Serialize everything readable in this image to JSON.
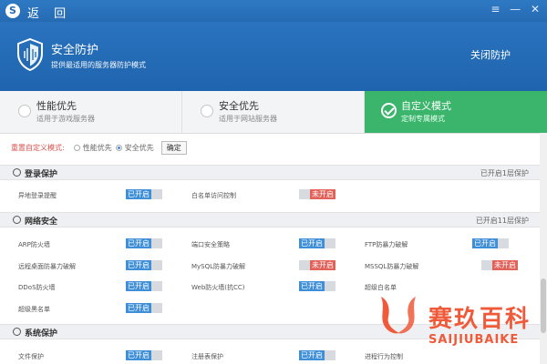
{
  "titlebar": {
    "back_label": "返 回",
    "logo_text": "S",
    "btn_menu": "≡",
    "btn_min": "—",
    "btn_close": "✕"
  },
  "banner": {
    "title": "安全防护",
    "subtitle": "提供最适用的服务器防护模式",
    "close_protect": "关闭防护"
  },
  "modes": [
    {
      "title": "性能优先",
      "subtitle": "适用于游戏服务器"
    },
    {
      "title": "安全优先",
      "subtitle": "适用于网站服务器"
    },
    {
      "title": "自定义模式",
      "subtitle": "定制专属模式"
    }
  ],
  "reset": {
    "label": "重置自定义模式:",
    "option1": "性能优先",
    "option2": "安全优先",
    "confirm": "确定"
  },
  "status_labels": {
    "on": "已开启",
    "off": "未开启"
  },
  "sections": {
    "login": {
      "title": "登录保护",
      "status": "已开启1层保护",
      "items": [
        {
          "label": "异地登录提醒",
          "state": "已开启"
        },
        {
          "label": "白名单访问控制",
          "state": "未开启"
        }
      ]
    },
    "network": {
      "title": "网络安全",
      "status": "已开启11层保护",
      "items": [
        {
          "label": "ARP防火墙",
          "state": "已开启"
        },
        {
          "label": "端口安全策略",
          "state": "已开启"
        },
        {
          "label": "FTP防暴力破解",
          "state": "已开启"
        },
        {
          "label": "远程桌面防暴力破解",
          "state": "已开启"
        },
        {
          "label": "MySQL防暴力破解",
          "state": "未开启"
        },
        {
          "label": "MSSQL防暴力破解",
          "state": "未开启"
        },
        {
          "label": "DDoS防火墙",
          "state": "已开启"
        },
        {
          "label": "Web防火墙(抗CC)",
          "state": "已开启"
        },
        {
          "label": "超级白名单",
          "state": ""
        },
        {
          "label": "超级黑名单",
          "state": "已开启"
        }
      ]
    },
    "system": {
      "title": "系统保护",
      "items": [
        {
          "label": "文件保护",
          "state": "已开启"
        },
        {
          "label": "注册表保护",
          "state": "已开启"
        },
        {
          "label": "进程行为控制",
          "state": ""
        }
      ]
    }
  },
  "watermark": {
    "cn": "赛玖百科",
    "en": "SAIJIUBAIKE"
  },
  "colors": {
    "primary": "#256bb3",
    "active_mode": "#3bb56c",
    "on": "#3e8ed8",
    "off": "#e2625a"
  }
}
